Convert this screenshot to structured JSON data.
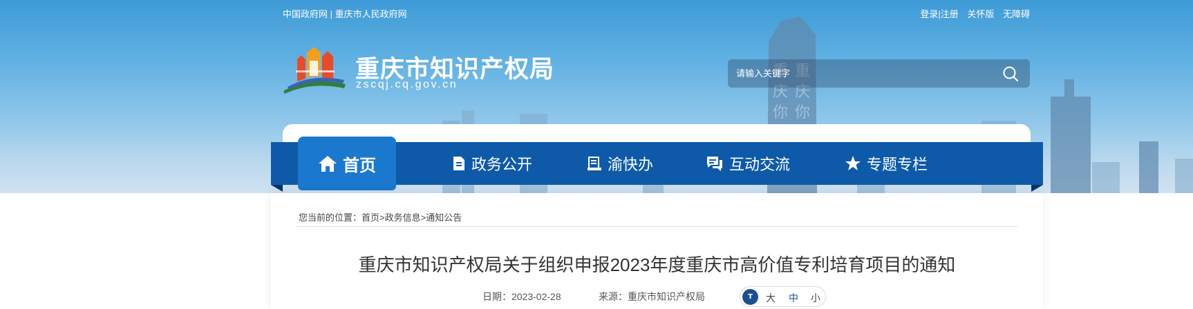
{
  "top_links": {
    "gov_cn": "中国政府网",
    "separator": "|",
    "cq_gov": "重庆市人民政府网",
    "login_register": "登录|注册",
    "care_mode": "关怀版",
    "accessibility": "无障碍"
  },
  "header": {
    "site_title": "重庆市知识产权局",
    "site_domain": "zscqj.cq.gov.cn"
  },
  "search": {
    "placeholder": "请输入关键字"
  },
  "nav": {
    "items": [
      {
        "label": "首页",
        "icon": "home-icon",
        "active": true
      },
      {
        "label": "政务公开",
        "icon": "document-icon"
      },
      {
        "label": "渝快办",
        "icon": "clipboard-icon"
      },
      {
        "label": "互动交流",
        "icon": "chat-icon"
      },
      {
        "label": "专题专栏",
        "icon": "star-icon"
      }
    ]
  },
  "breadcrumb": {
    "prefix": "您当前的位置：",
    "home": "首页",
    "sep1": ">",
    "level1": "政务信息",
    "sep2": ">",
    "level2": "通知公告"
  },
  "article": {
    "title": "重庆市知识产权局关于组织申报2023年度重庆市高价值专利培育项目的通知",
    "date_label": "日期：",
    "date": "2023-02-28",
    "source_label": "来源：",
    "source": "重庆市知识产权局"
  },
  "font_size": {
    "icon_text": "T",
    "large": "大",
    "medium": "中",
    "small": "小"
  },
  "colors": {
    "nav_bg": "#0e5aa8",
    "nav_active": "#1a78cf",
    "accent_dark": "#1c4f8f"
  }
}
